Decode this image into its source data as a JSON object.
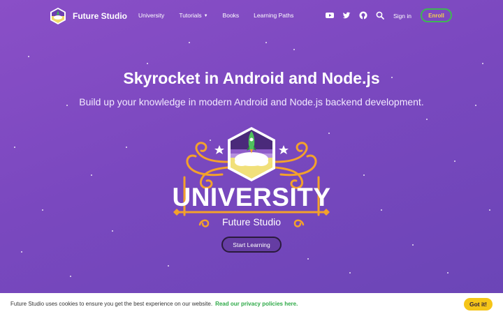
{
  "nav": {
    "brand": "Future Studio",
    "links": [
      "University",
      "Tutorials",
      "Books",
      "Learning Paths"
    ],
    "icons": [
      "youtube-icon",
      "twitter-icon",
      "github-icon",
      "search-icon"
    ],
    "signin": "Sign in",
    "enroll": "Enroll"
  },
  "hero": {
    "title": "Skyrocket in Android and Node.js",
    "subtitle": "Build up your knowledge in modern Android and Node.js backend development.",
    "emblem_title": "UNIVERSITY",
    "emblem_subtitle": "Future Studio",
    "cta": "Start Learning"
  },
  "cookie": {
    "text": "Future Studio uses cookies to ensure you get the best experience on our website.",
    "link": "Read our privacy policies here.",
    "button": "Got it!"
  },
  "colors": {
    "background": "#7a48bf",
    "accent_orange": "#f3a12c",
    "enroll_border": "#3fb654",
    "cookie_link": "#2eaa48",
    "gotit_bg": "#f5c518"
  }
}
